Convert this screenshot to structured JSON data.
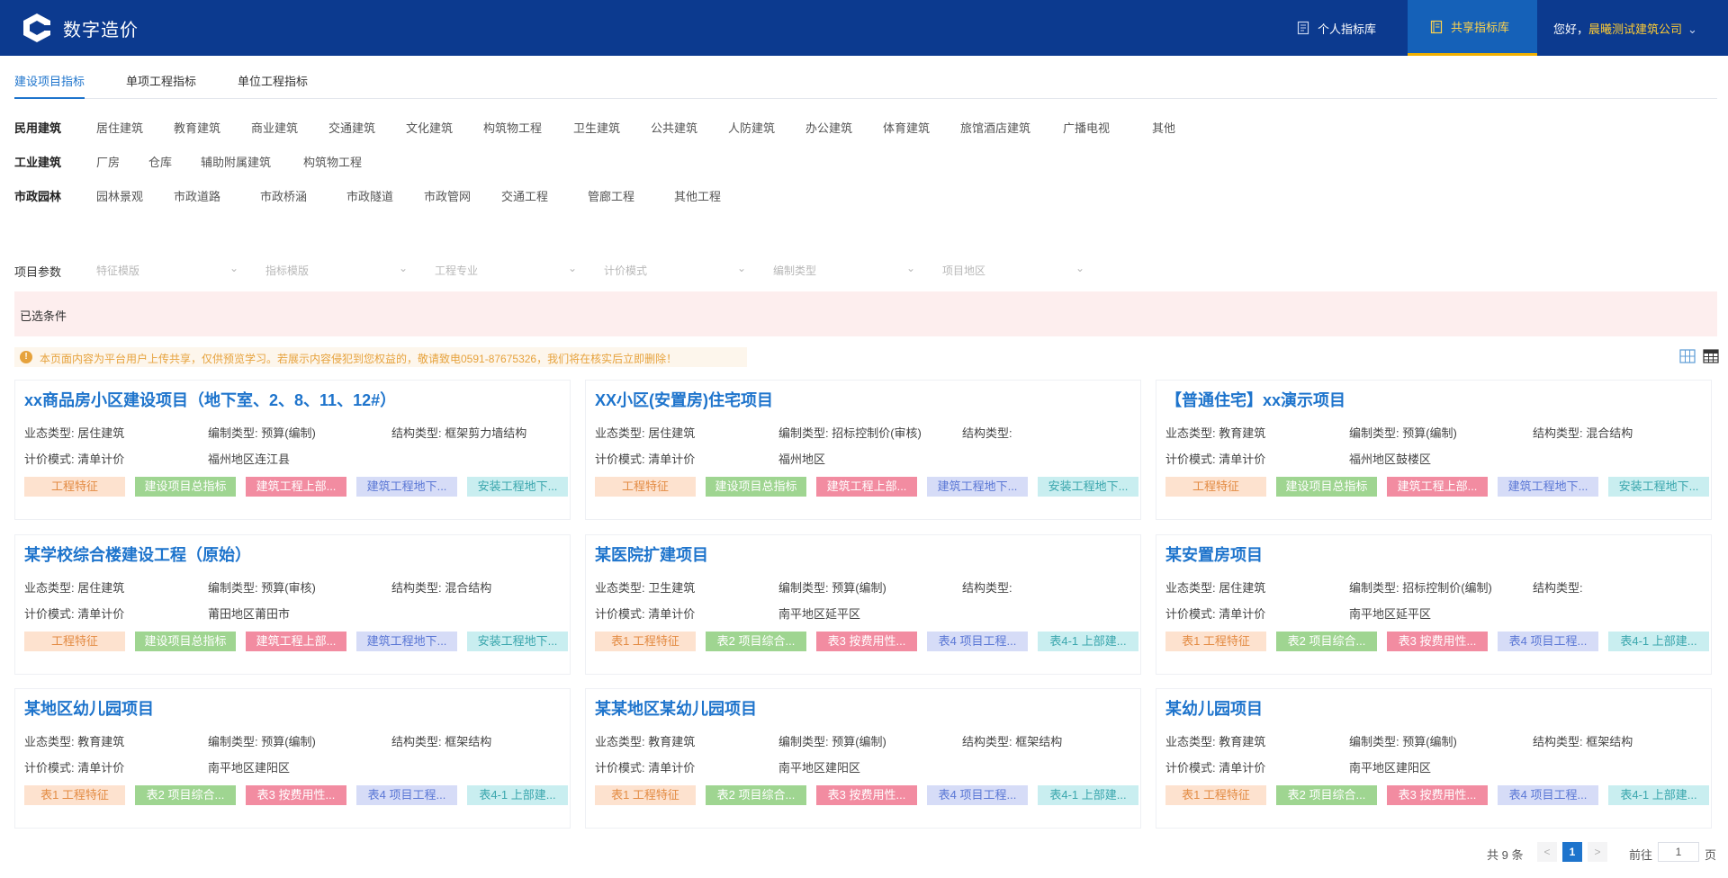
{
  "header": {
    "title": "数字造价",
    "nav": [
      {
        "label": "个人指标库"
      },
      {
        "label": "共享指标库"
      }
    ],
    "greeting": "您好，",
    "company": "晨曦测试建筑公司"
  },
  "tabs": [
    "建设项目指标",
    "单项工程指标",
    "单位工程指标"
  ],
  "categories": [
    {
      "title": "民用建筑",
      "items": [
        "居住建筑",
        "教育建筑",
        "商业建筑",
        "交通建筑",
        "文化建筑",
        "构筑物工程",
        "卫生建筑",
        "公共建筑",
        "人防建筑",
        "办公建筑",
        "体育建筑",
        "旅馆酒店建筑",
        "广播电视",
        "其他"
      ]
    },
    {
      "title": "工业建筑",
      "items": [
        "厂房",
        "仓库",
        "辅助附属建筑",
        "构筑物工程"
      ]
    },
    {
      "title": "市政园林",
      "items": [
        "园林景观",
        "市政道路",
        "市政桥涵",
        "市政隧道",
        "市政管网",
        "交通工程",
        "管廊工程",
        "其他工程"
      ]
    }
  ],
  "params": {
    "label": "项目参数",
    "selects": [
      "特征模版",
      "指标模版",
      "工程专业",
      "计价模式",
      "编制类型",
      "项目地区"
    ]
  },
  "conditions_label": "已选条件",
  "notice": "本页面内容为平台用户上传共享，仅供预览学习。若展示内容侵犯到您权益的，敬请致电0591-87675326，我们将在核实后立即删除！",
  "cards": [
    {
      "title": "xx商品房小区建设项目（地下室、2、8、11、12#）",
      "business": "业态类型: 居住建筑",
      "compile": "编制类型: 预算(编制)",
      "structure": "结构类型: 框架剪力墙结构",
      "pricing": "计价模式: 清单计价",
      "region": "福州地区连江县",
      "tags": [
        "工程特征",
        "建设项目总指标",
        "建筑工程上部...",
        "建筑工程地下...",
        "安装工程地下..."
      ]
    },
    {
      "title": "XX小区(安置房)住宅项目",
      "business": "业态类型: 居住建筑",
      "compile": "编制类型: 招标控制价(审核)",
      "structure": "结构类型:",
      "pricing": "计价模式: 清单计价",
      "region": "福州地区",
      "tags": [
        "工程特征",
        "建设项目总指标",
        "建筑工程上部...",
        "建筑工程地下...",
        "安装工程地下..."
      ]
    },
    {
      "title": "【普通住宅】xx演示项目",
      "business": "业态类型: 教育建筑",
      "compile": "编制类型: 预算(编制)",
      "structure": "结构类型: 混合结构",
      "pricing": "计价模式: 清单计价",
      "region": "福州地区鼓楼区",
      "tags": [
        "工程特征",
        "建设项目总指标",
        "建筑工程上部...",
        "建筑工程地下...",
        "安装工程地下..."
      ]
    },
    {
      "title": "某学校综合楼建设工程（原始）",
      "business": "业态类型: 居住建筑",
      "compile": "编制类型: 预算(审核)",
      "structure": "结构类型: 混合结构",
      "pricing": "计价模式: 清单计价",
      "region": "莆田地区莆田市",
      "tags": [
        "工程特征",
        "建设项目总指标",
        "建筑工程上部...",
        "建筑工程地下...",
        "安装工程地下..."
      ]
    },
    {
      "title": "某医院扩建项目",
      "business": "业态类型: 卫生建筑",
      "compile": "编制类型: 预算(编制)",
      "structure": "结构类型:",
      "pricing": "计价模式: 清单计价",
      "region": "南平地区延平区",
      "tags": [
        "表1 工程特征",
        "表2 项目综合...",
        "表3 按费用性...",
        "表4 项目工程...",
        "表4-1 上部建..."
      ]
    },
    {
      "title": "某安置房项目",
      "business": "业态类型: 居住建筑",
      "compile": "编制类型: 招标控制价(编制)",
      "structure": "结构类型:",
      "pricing": "计价模式: 清单计价",
      "region": "南平地区延平区",
      "tags": [
        "表1 工程特征",
        "表2 项目综合...",
        "表3 按费用性...",
        "表4 项目工程...",
        "表4-1 上部建..."
      ]
    },
    {
      "title": "某地区幼儿园项目",
      "business": "业态类型: 教育建筑",
      "compile": "编制类型: 预算(编制)",
      "structure": "结构类型: 框架结构",
      "pricing": "计价模式: 清单计价",
      "region": "南平地区建阳区",
      "tags": [
        "表1 工程特征",
        "表2 项目综合...",
        "表3 按费用性...",
        "表4 项目工程...",
        "表4-1 上部建..."
      ]
    },
    {
      "title": "某某地区某幼儿园项目",
      "business": "业态类型: 教育建筑",
      "compile": "编制类型: 预算(编制)",
      "structure": "结构类型: 框架结构",
      "pricing": "计价模式: 清单计价",
      "region": "南平地区建阳区",
      "tags": [
        "表1 工程特征",
        "表2 项目综合...",
        "表3 按费用性...",
        "表4 项目工程...",
        "表4-1 上部建..."
      ]
    },
    {
      "title": "某幼儿园项目",
      "business": "业态类型: 教育建筑",
      "compile": "编制类型: 预算(编制)",
      "structure": "结构类型: 框架结构",
      "pricing": "计价模式: 清单计价",
      "region": "南平地区建阳区",
      "tags": [
        "表1 工程特征",
        "表2 项目综合...",
        "表3 按费用性...",
        "表4 项目工程...",
        "表4-1 上部建..."
      ]
    }
  ],
  "pagination": {
    "total": "共 9 条",
    "prev": "<",
    "current": "1",
    "next": ">",
    "goto": "前往",
    "input": "1",
    "page_suffix": "页"
  },
  "colors": {
    "header_bg": "#0c3a8f",
    "accent": "#1e74cc",
    "active_nav": "#1561b8",
    "company": "#ffcc33"
  },
  "icons": [
    "logo-icon",
    "document-icon",
    "book-icon",
    "chevron-down-icon",
    "warning-icon",
    "grid-view-icon",
    "table-view-icon"
  ]
}
